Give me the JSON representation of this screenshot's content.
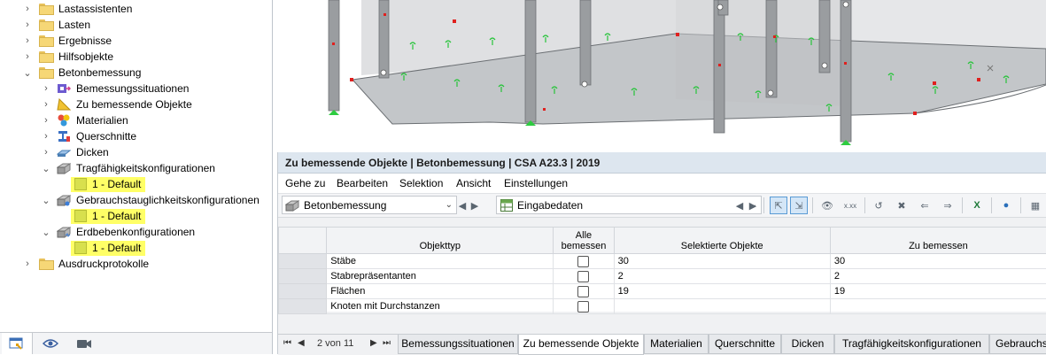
{
  "navigator": {
    "items": [
      {
        "label": "Lastassistenten",
        "expanded": false,
        "icon": "folder-icon"
      },
      {
        "label": "Lasten",
        "expanded": false,
        "icon": "folder-icon"
      },
      {
        "label": "Ergebnisse",
        "expanded": false,
        "icon": "folder-icon"
      },
      {
        "label": "Hilfsobjekte",
        "expanded": false,
        "icon": "folder-icon"
      },
      {
        "label": "Betonbemessung",
        "expanded": true,
        "icon": "folder-icon"
      },
      {
        "label": "Bemessungssituationen",
        "expanded": false,
        "icon": "design-situations-icon"
      },
      {
        "label": "Zu bemessende Objekte",
        "expanded": false,
        "icon": "objects-to-design-icon"
      },
      {
        "label": "Materialien",
        "expanded": false,
        "icon": "materials-icon"
      },
      {
        "label": "Querschnitte",
        "expanded": false,
        "icon": "cross-section-icon"
      },
      {
        "label": "Dicken",
        "expanded": false,
        "icon": "thickness-icon"
      },
      {
        "label": "Tragfähigkeitskonfigurationen",
        "expanded": true,
        "icon": "configuration-icon"
      },
      {
        "label": "1 - Default",
        "highlight": true
      },
      {
        "label": "Gebrauchstauglichkeitskonfigurationen",
        "expanded": true,
        "icon": "configuration-icon"
      },
      {
        "label": "1 - Default",
        "highlight": true
      },
      {
        "label": "Erdbebenkonfigurationen",
        "expanded": true,
        "icon": "configuration-icon"
      },
      {
        "label": "1 - Default",
        "highlight": true
      },
      {
        "label": "Ausdruckprotokolle",
        "expanded": false,
        "icon": "folder-icon"
      }
    ],
    "tabs": [
      "data-icon",
      "eye-icon",
      "camera-icon"
    ]
  },
  "panel": {
    "title": "Zu bemessende Objekte | Betonbemessung | CSA A23.3 | 2019",
    "menu": [
      "Gehe zu",
      "Bearbeiten",
      "Selektion",
      "Ansicht",
      "Einstellungen"
    ],
    "combo_module": "Betonbemessung",
    "combo_table": "Eingabedaten",
    "columns": [
      "Objekttyp",
      "Alle bemessen",
      "Selektierte Objekte",
      "Zu bemessen"
    ],
    "rows": [
      {
        "type": "Stäbe",
        "all": false,
        "selected": "30",
        "to_design": "30"
      },
      {
        "type": "Stabrepräsentanten",
        "all": false,
        "selected": "2",
        "to_design": "2"
      },
      {
        "type": "Flächen",
        "all": false,
        "selected": "19",
        "to_design": "19"
      },
      {
        "type": "Knoten mit Durchstanzen",
        "all": false,
        "selected": "",
        "to_design": ""
      }
    ],
    "pager": "2 von 11",
    "tabs": [
      "Bemessungssituationen",
      "Zu bemessende Objekte",
      "Materialien",
      "Querschnitte",
      "Dicken",
      "Tragfähigkeitskonfigurationen",
      "Gebrauchst"
    ],
    "active_tab": 1
  },
  "colors": {
    "accent": "#5a9bd5",
    "highlight": "#ffff66",
    "support": "#2ecc40",
    "node": "#e0201e"
  }
}
